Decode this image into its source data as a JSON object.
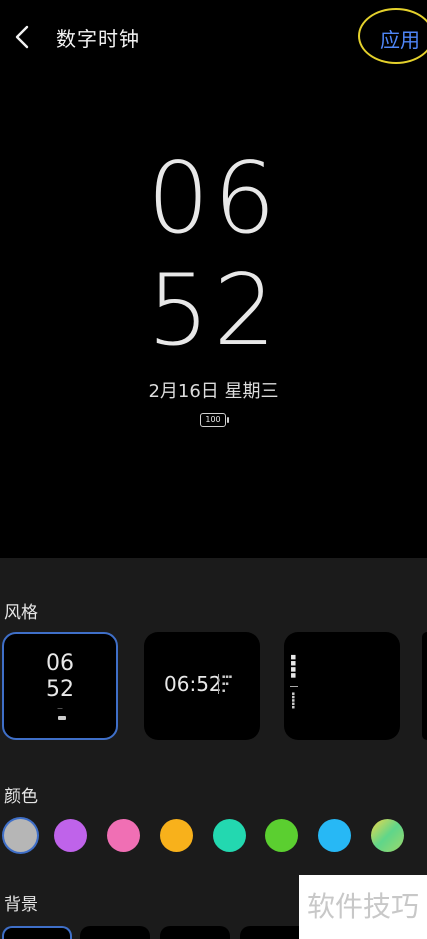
{
  "header": {
    "title": "数字时钟",
    "apply_label": "应用",
    "back_icon": "chevron-left-icon"
  },
  "preview": {
    "hour": "06",
    "minute": "52",
    "date": "2月16日  星期三",
    "battery": "100"
  },
  "sections": {
    "style": "风格",
    "color": "颜色",
    "background": "背景"
  },
  "styles": [
    {
      "hour": "06",
      "minute": "52",
      "selected": true
    },
    {
      "time": "06:52",
      "selected": false
    },
    {
      "selected": false
    }
  ],
  "colors": [
    "#b6b6b6",
    "#bf63ea",
    "#f06fb4",
    "#f8b11b",
    "#23d8b0",
    "#5bcf30",
    "#27b8f5",
    "#9ed86a"
  ],
  "accent_color": "#4f86f7",
  "watermark": "软件技巧"
}
